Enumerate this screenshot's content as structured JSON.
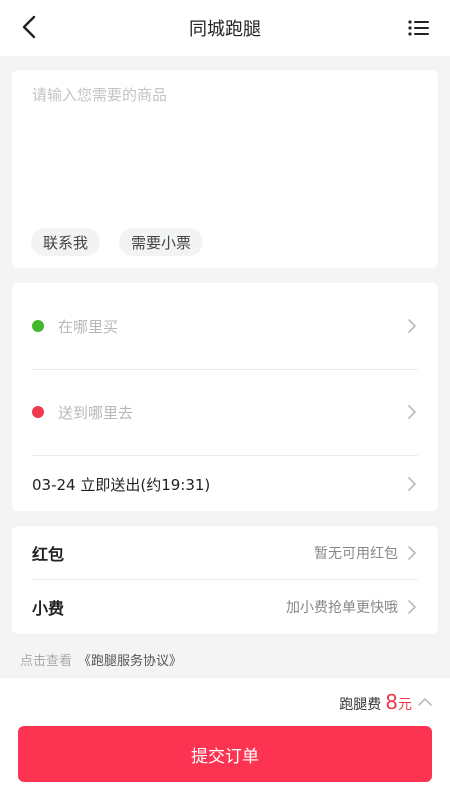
{
  "header": {
    "title": "同城跑腿"
  },
  "goods": {
    "placeholder": "请输入您需要的商品",
    "value": "",
    "chips": [
      "联系我",
      "需要小票"
    ]
  },
  "address": {
    "buy_placeholder": "在哪里买",
    "send_placeholder": "送到哪里去",
    "time_value": "03-24 立即送出(约19:31)",
    "buy_dot_color": "#3fb82c",
    "send_dot_color": "#f0384e"
  },
  "fees": {
    "redpacket_label": "红包",
    "redpacket_hint": "暂无可用红包",
    "tip_label": "小费",
    "tip_hint": "加小费抢单更快哦"
  },
  "agreement": {
    "prefix": "点击查看",
    "link": "《跑腿服务协议》"
  },
  "bottom": {
    "fee_label": "跑腿费",
    "fee_amount": "8",
    "fee_unit": "元",
    "submit_label": "提交订单",
    "accent_color": "#fd3352"
  }
}
